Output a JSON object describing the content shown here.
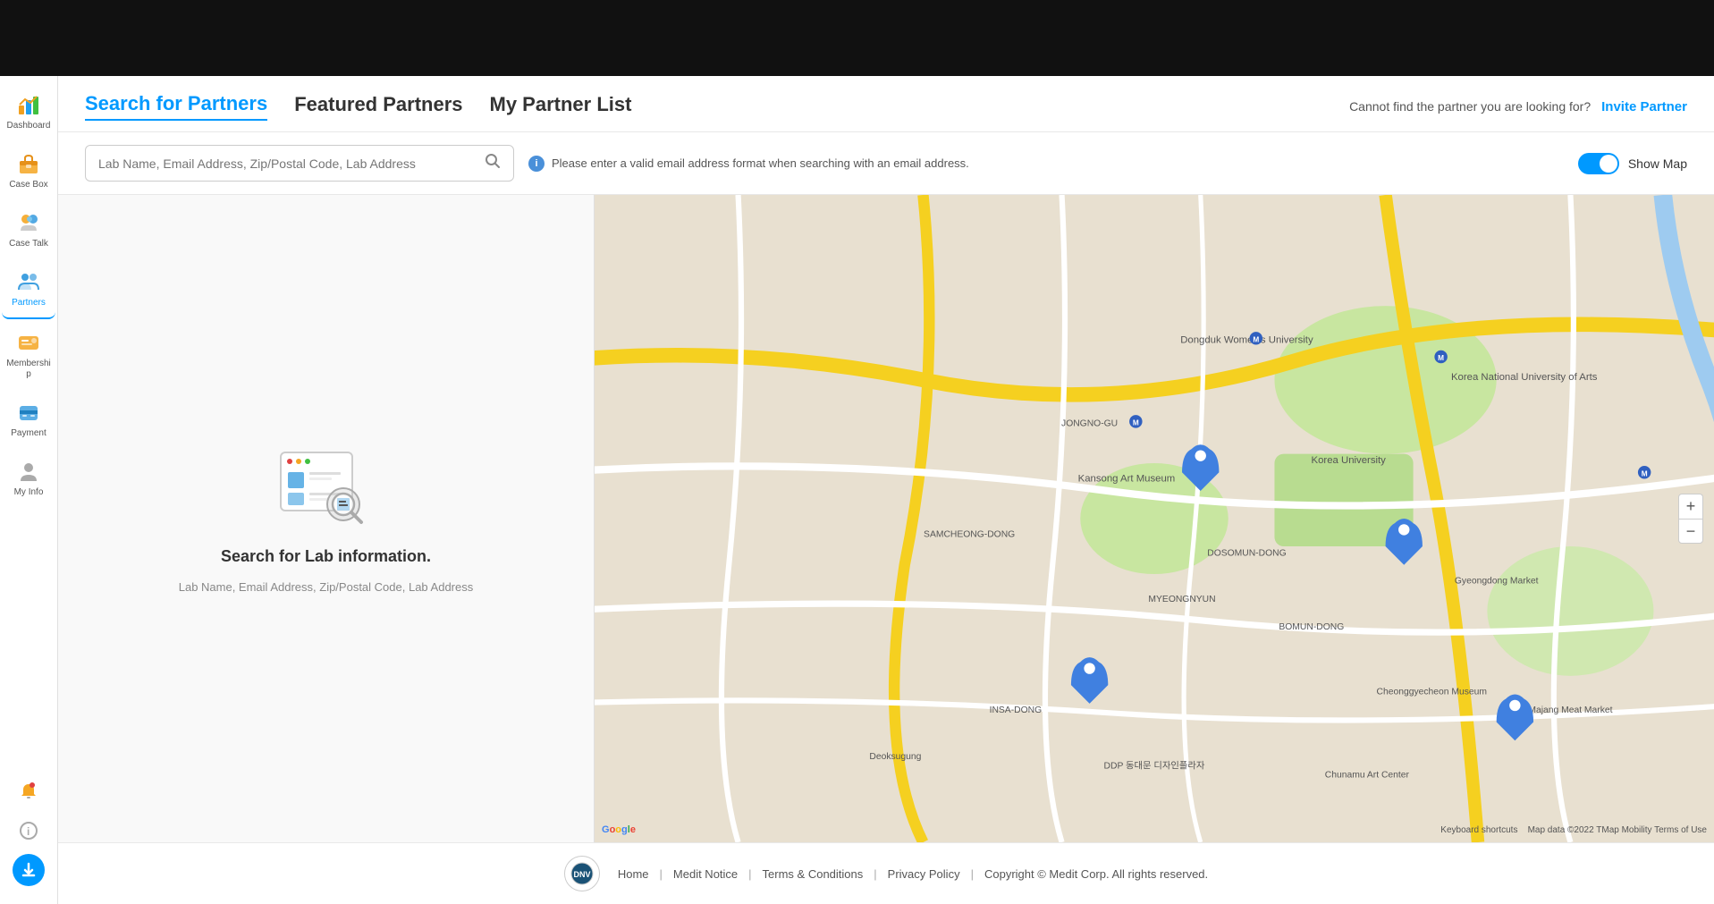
{
  "topbar": {},
  "sidebar": {
    "items": [
      {
        "id": "dashboard",
        "label": "Dashboard",
        "icon": "dashboard-icon",
        "active": false
      },
      {
        "id": "casebox",
        "label": "Case Box",
        "icon": "casebox-icon",
        "active": false
      },
      {
        "id": "casetalk",
        "label": "Case Talk",
        "icon": "casetalk-icon",
        "active": false
      },
      {
        "id": "partners",
        "label": "Partners",
        "icon": "partners-icon",
        "active": true
      },
      {
        "id": "membership",
        "label": "Membership",
        "icon": "membership-icon",
        "active": false
      },
      {
        "id": "payment",
        "label": "Payment",
        "icon": "payment-icon",
        "active": false
      },
      {
        "id": "myinfo",
        "label": "My Info",
        "icon": "myinfo-icon",
        "active": false
      }
    ],
    "bottom_icons": [
      {
        "id": "notification",
        "icon": "notification-icon"
      },
      {
        "id": "info",
        "icon": "info-icon"
      },
      {
        "id": "download",
        "icon": "download-icon",
        "style": "blue-circle"
      }
    ]
  },
  "header": {
    "tabs": [
      {
        "id": "search",
        "label": "Search for Partners",
        "active": true
      },
      {
        "id": "featured",
        "label": "Featured Partners",
        "active": false
      },
      {
        "id": "mylist",
        "label": "My Partner List",
        "active": false
      }
    ],
    "cannot_find_text": "Cannot find the partner you are looking for?",
    "invite_button": "Invite Partner"
  },
  "search": {
    "placeholder": "Lab Name, Email Address, Zip/Postal Code, Lab Address",
    "info_message": "Please enter a valid email address format when searching with an email address.",
    "show_map_label": "Show Map",
    "show_map_enabled": true
  },
  "empty_state": {
    "title": "Search for Lab information.",
    "subtitle": "Lab Name, Email Address, Zip/Postal Code, Lab Address"
  },
  "map": {
    "zoom_in": "+",
    "zoom_out": "−",
    "attribution": "Map data ©2022 TMap Mobility  Terms of Use",
    "google_logo": "Google",
    "keyboard_shortcuts": "Keyboard shortcuts"
  },
  "footer": {
    "home": "Home",
    "medit_notice": "Medit Notice",
    "terms": "Terms & Conditions",
    "privacy": "Privacy Policy",
    "copyright": "Copyright © Medit Corp. All rights reserved."
  }
}
